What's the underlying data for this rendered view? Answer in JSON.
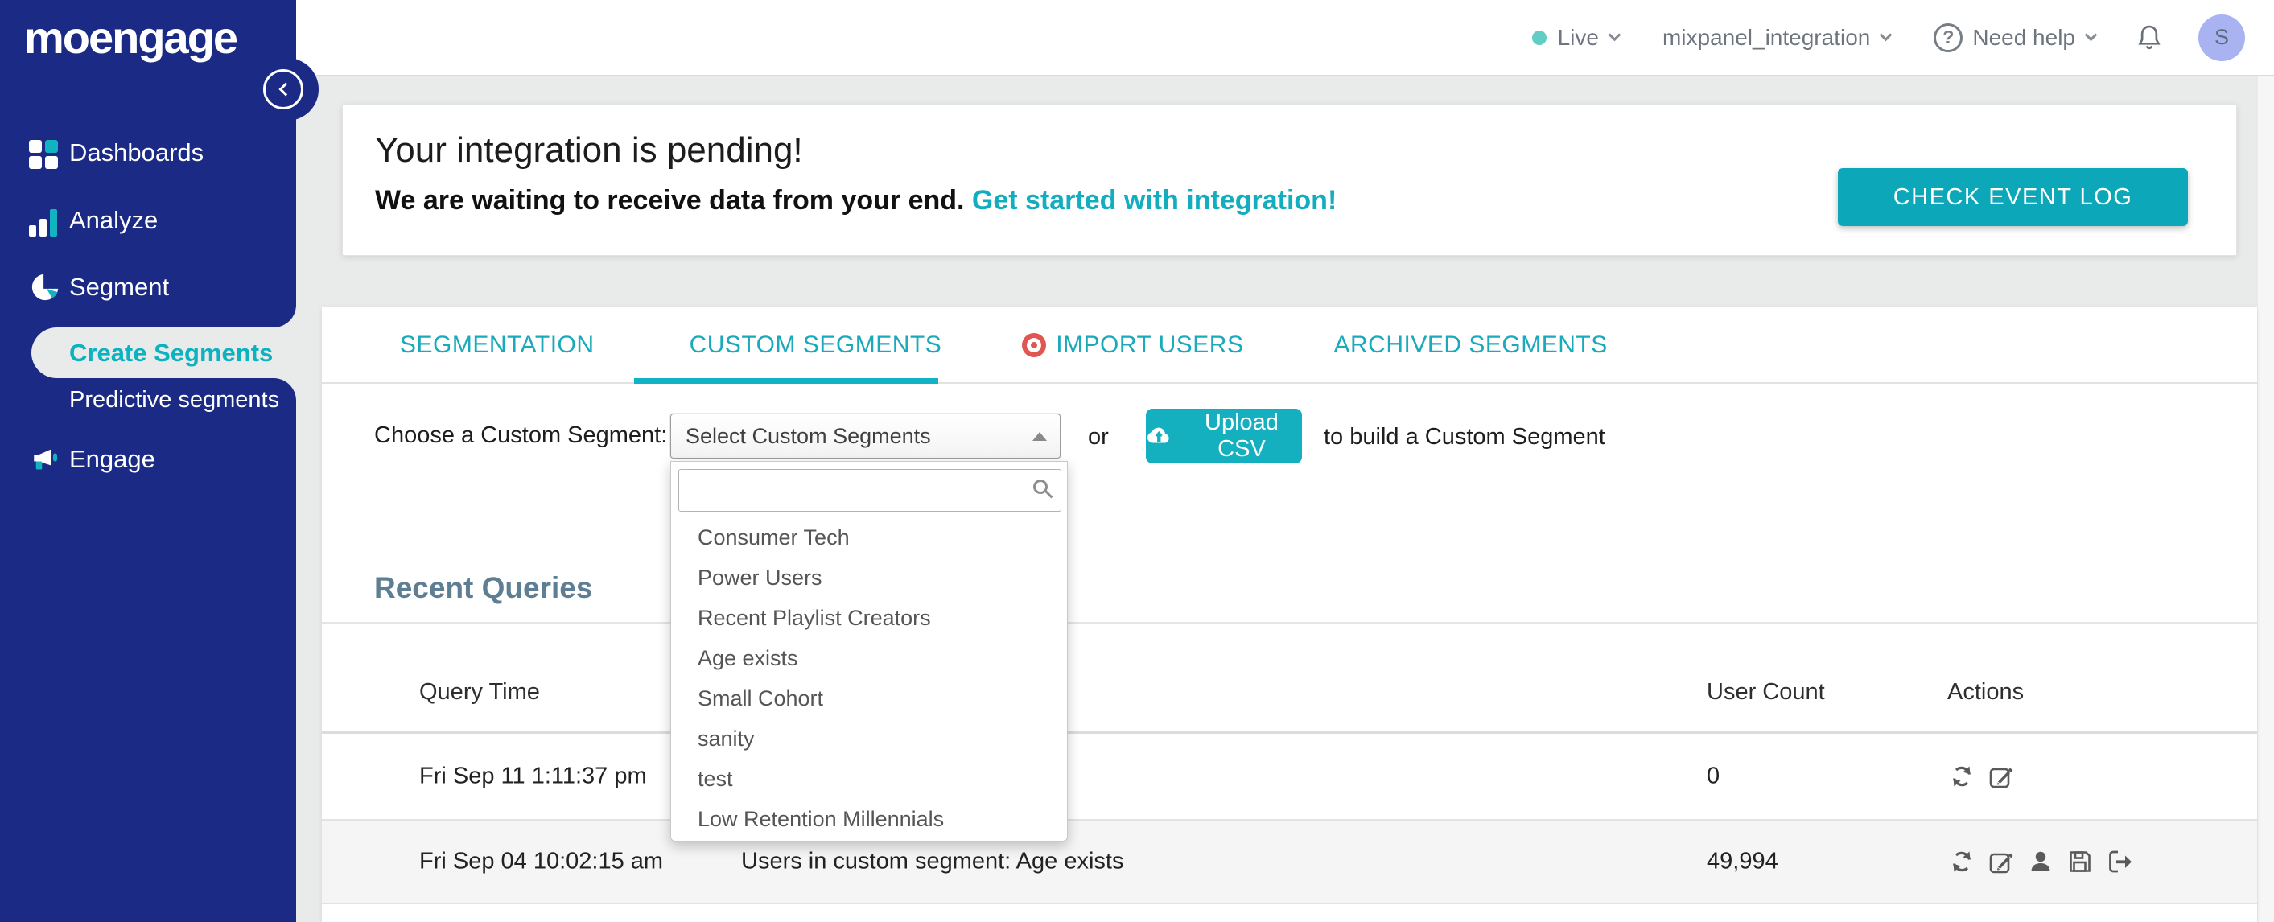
{
  "colors": {
    "sidebar_bg": "#1a2a85",
    "accent_teal": "#0ca7b9",
    "active_item_teal": "#0cb2c0",
    "import_dot_red": "#e05752",
    "live_dot_teal": "#62cdc5",
    "avatar_bg": "#aab3f2",
    "recent_queries_heading": "#5e7e93"
  },
  "brand": {
    "logo_text": "moengage"
  },
  "sidebar": {
    "collapse_icon": "chevron-left-icon",
    "items": [
      {
        "label": "Dashboards",
        "icon": "grid-icon"
      },
      {
        "label": "Analyze",
        "icon": "bar-chart-icon"
      },
      {
        "label": "Segment",
        "icon": "pie-chart-icon"
      },
      {
        "label": "Create Segments",
        "active": true
      },
      {
        "label": "Predictive segments"
      },
      {
        "label": "Engage",
        "icon": "megaphone-icon"
      }
    ]
  },
  "header": {
    "env_label": "Live",
    "env_icon": "live-status-dot",
    "project": "mixpanel_integration",
    "help_icon": "question-circle-icon",
    "help": "Need help",
    "bell_icon": "bell-icon",
    "avatar_initial": "S"
  },
  "banner": {
    "title": "Your integration is pending!",
    "message": "We are waiting to receive data from your end.",
    "link_text": "Get started with integration!",
    "button_label": "CHECK EVENT LOG"
  },
  "tabs": {
    "items": [
      {
        "label": "SEGMENTATION",
        "active": false
      },
      {
        "label": "CUSTOM SEGMENTS",
        "active": true
      },
      {
        "label": "IMPORT USERS",
        "active": false,
        "icon": "red-target-dot-icon"
      },
      {
        "label": "ARCHIVED SEGMENTS",
        "active": false
      }
    ]
  },
  "chooser": {
    "label": "Choose a Custom Segment:",
    "select_value": "Select Custom Segments",
    "select_caret": "caret-up-icon",
    "or_text": "or",
    "upload_icon": "cloud-upload-icon",
    "upload_button_label": "Upload CSV",
    "suffix_text": "to build a Custom Segment"
  },
  "dropdown": {
    "search_placeholder": "",
    "search_icon": "search-icon",
    "options": [
      "Consumer Tech",
      "Power Users",
      "Recent Playlist Creators",
      "Age exists",
      "Small Cohort",
      "sanity",
      "test",
      "Low Retention Millennials"
    ]
  },
  "recent": {
    "title": "Recent Queries",
    "col_query_time": "Query Time",
    "col_user_count": "User Count",
    "col_actions": "Actions",
    "rows": [
      {
        "query_time": "Fri Sep 11 1:11:37 pm",
        "query": "",
        "user_count": "0",
        "actions": [
          "refresh-icon",
          "edit-icon"
        ]
      },
      {
        "query_time": "Fri Sep 04 10:02:15 am",
        "query": "Users in custom segment: Age exists",
        "user_count": "49,994",
        "actions": [
          "refresh-icon",
          "edit-icon",
          "user-icon",
          "save-icon",
          "export-icon"
        ]
      }
    ]
  }
}
